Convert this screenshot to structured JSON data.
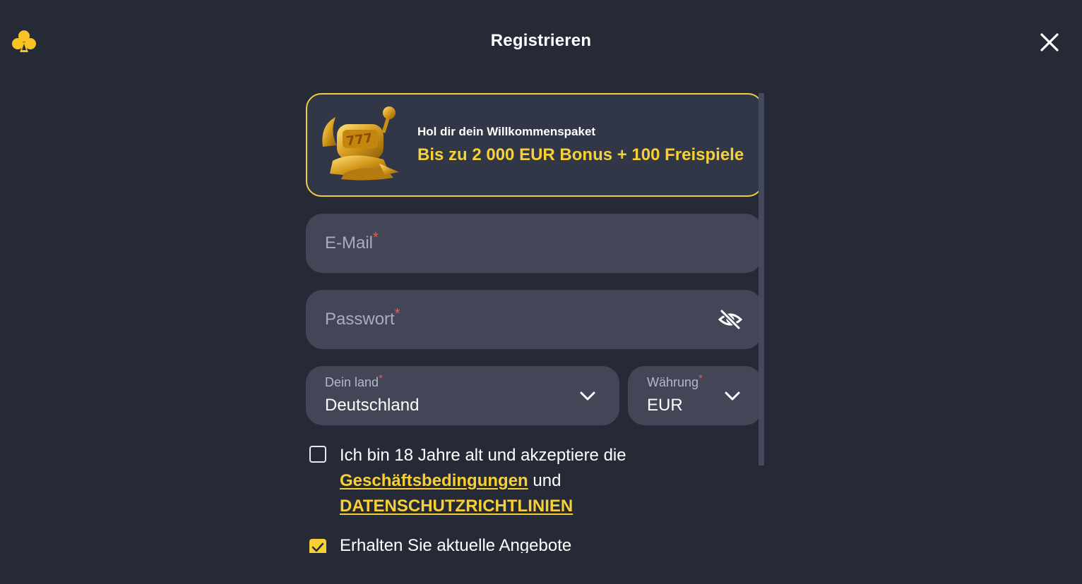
{
  "header": {
    "title": "Registrieren",
    "logo_icon": "club-logo-icon",
    "close_icon": "close-icon"
  },
  "promo": {
    "subtitle": "Hol dir dein Willkommenspaket",
    "headline": "Bis zu 2 000 EUR Bonus + 100 Freispiele",
    "image_icon": "slot-machine-icon"
  },
  "form": {
    "email": {
      "placeholder": "E-Mail",
      "required_mark": "*",
      "value": ""
    },
    "password": {
      "placeholder": "Passwort",
      "required_mark": "*",
      "value": "",
      "toggle_icon": "eye-off-icon"
    },
    "country": {
      "label": "Dein land",
      "required_mark": "*",
      "value": "Deutschland"
    },
    "currency": {
      "label": "Währung",
      "required_mark": "*",
      "value": "EUR"
    },
    "terms": {
      "checked": false,
      "text_before": "Ich bin 18 Jahre alt und akzeptiere die ",
      "link_terms": "Geschäftsbedingungen",
      "text_middle": " und ",
      "link_privacy": "DATENSCHUTZRICHTLINIEN"
    },
    "offers": {
      "checked": true,
      "text": "Erhalten Sie aktuelle Angebote"
    }
  },
  "colors": {
    "background": "#262a36",
    "field": "#424657",
    "accent": "#f7d036",
    "required": "#ee5a45"
  }
}
